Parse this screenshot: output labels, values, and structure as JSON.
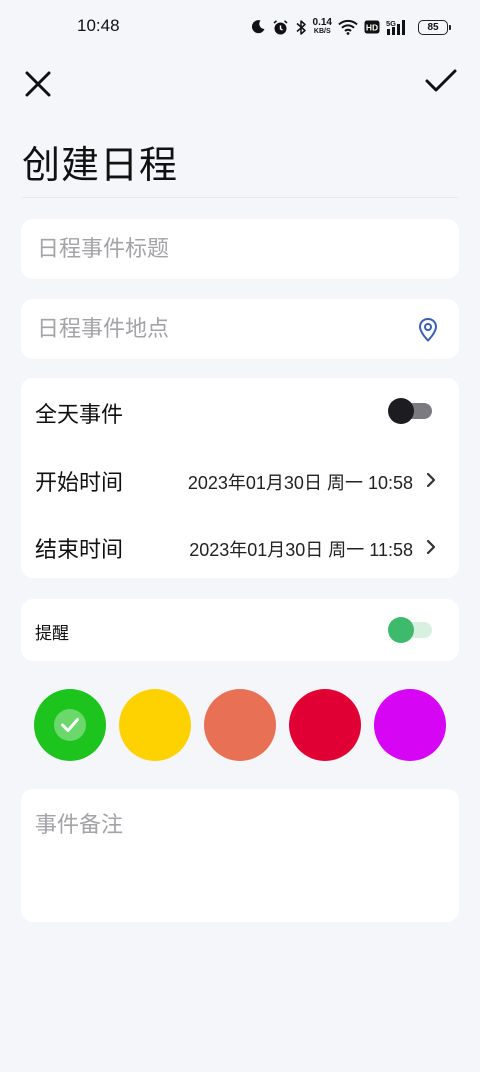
{
  "status_bar": {
    "time": "10:48",
    "net_speed_value": "0.14",
    "net_speed_unit": "KB/S",
    "hd_label": "HD",
    "signal_label": "5G",
    "battery": "85",
    "icons": [
      "moon-icon",
      "alarm-icon",
      "bluetooth-icon",
      "wifi-icon",
      "hd-icon",
      "signal-icon",
      "battery-icon"
    ]
  },
  "toolbar": {
    "close_icon": "close-icon",
    "confirm_icon": "check-icon"
  },
  "page": {
    "title": "创建日程"
  },
  "form": {
    "title_placeholder": "日程事件标题",
    "title_value": "",
    "location_placeholder": "日程事件地点",
    "location_value": "",
    "location_icon": "location-pin-icon",
    "all_day_label": "全天事件",
    "all_day_on": false,
    "start_label": "开始时间",
    "start_value": "2023年01月30日 周一 10:58",
    "end_label": "结束时间",
    "end_value": "2023年01月30日 周一 11:58",
    "reminder_label": "提醒",
    "reminder_on": true,
    "note_placeholder": "事件备注",
    "note_value": ""
  },
  "colors": {
    "selected_index": 0,
    "options": [
      "#1dc41d",
      "#fed200",
      "#e87155",
      "#e00034",
      "#d605f4"
    ]
  }
}
